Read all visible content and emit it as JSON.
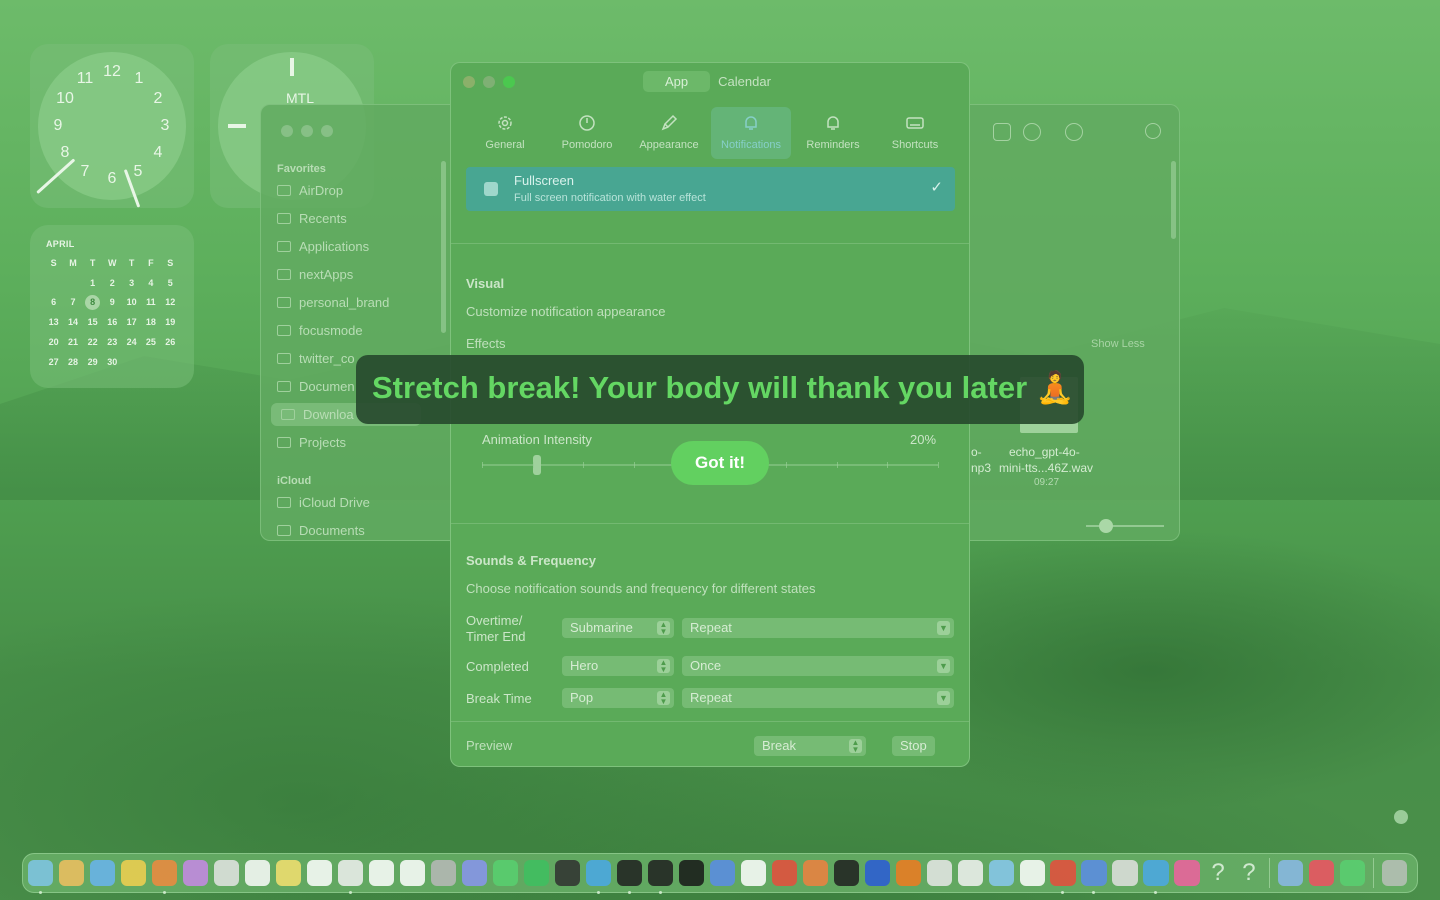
{
  "calendar": {
    "month": "APRIL",
    "weekdays": [
      "S",
      "M",
      "T",
      "W",
      "T",
      "F",
      "S"
    ],
    "weeks": [
      [
        "",
        "",
        "1",
        "2",
        "3",
        "4",
        "5"
      ],
      [
        "6",
        "7",
        "8",
        "9",
        "10",
        "11",
        "12"
      ],
      [
        "13",
        "14",
        "15",
        "16",
        "17",
        "18",
        "19"
      ],
      [
        "20",
        "21",
        "22",
        "23",
        "24",
        "25",
        "26"
      ],
      [
        "27",
        "28",
        "29",
        "30",
        "",
        "",
        ""
      ]
    ],
    "today": "8"
  },
  "clock": {
    "numbers": [
      "12",
      "1",
      "2",
      "3",
      "4",
      "5",
      "6",
      "7",
      "8",
      "9",
      "10",
      "11"
    ],
    "city_label": "MTL"
  },
  "finder": {
    "favorites_header": "Favorites",
    "favorites": [
      "AirDrop",
      "Recents",
      "Applications",
      "nextApps",
      "personal_brand",
      "focusmode",
      "twitter_co",
      "Documen",
      "Downloa",
      "Projects"
    ],
    "icloud_header": "iCloud",
    "icloud": [
      "iCloud Drive",
      "Documents"
    ],
    "show_less": "Show Less",
    "file_name_line1": "echo_gpt-4o-",
    "file_name_line2": "mini-tts...46Z.wav",
    "file_time": "09:27",
    "file_partial_1": "o-",
    "file_partial_2": "np3"
  },
  "window": {
    "segments": [
      "App",
      "Calendar"
    ],
    "active_segment": "App",
    "tabs": [
      {
        "label": "General",
        "icon": "gear-icon"
      },
      {
        "label": "Pomodoro",
        "icon": "timer-icon"
      },
      {
        "label": "Appearance",
        "icon": "paintbrush-icon"
      },
      {
        "label": "Notifications",
        "icon": "bell-icon"
      },
      {
        "label": "Reminders",
        "icon": "bell-badge-icon"
      },
      {
        "label": "Shortcuts",
        "icon": "keyboard-icon"
      }
    ],
    "active_tab": "Notifications",
    "fullscreen": {
      "title": "Fullscreen",
      "description": "Full screen notification with water effect"
    },
    "visual": {
      "header": "Visual",
      "subtitle": "Customize notification appearance",
      "effects_label": "Effects",
      "animation_label": "Animation Intensity",
      "animation_value": "20%",
      "animation_fraction": 0.12
    },
    "sounds": {
      "header": "Sounds & Frequency",
      "subtitle": "Choose notification sounds and frequency for different states",
      "rows": [
        {
          "label_line1": "Overtime/",
          "label_line2": "Timer End",
          "sound": "Submarine",
          "frequency": "Repeat"
        },
        {
          "label_line1": "Completed",
          "label_line2": "",
          "sound": "Hero",
          "frequency": "Once"
        },
        {
          "label_line1": "Break Time",
          "label_line2": "",
          "sound": "Pop",
          "frequency": "Repeat"
        }
      ]
    },
    "preview": {
      "label": "Preview",
      "selected": "Break",
      "stop_label": "Stop"
    }
  },
  "notification": {
    "message": "Stretch break! Your body will thank you later 🧘",
    "button_label": "Got it!"
  },
  "dock": {
    "icons": [
      "finder-icon",
      "launchpad-icon",
      "safari-icon",
      "chrome-icon",
      "brave-icon",
      "app-icon",
      "app-icon",
      "reminders-icon",
      "notes-icon",
      "notion-icon",
      "app-icon",
      "calendar-icon",
      "calendar-icon",
      "settings-icon",
      "discord-icon",
      "whatsapp-icon",
      "spotify-icon",
      "activity-monitor-icon",
      "docker-icon",
      "app-icon",
      "app-icon",
      "app-icon",
      "xcode-icon",
      "app-icon",
      "app-icon",
      "app-icon",
      "figma-icon",
      "bitwarden-icon",
      "vlc-icon",
      "app-icon",
      "app-icon",
      "app-icon",
      "chatgpt-icon",
      "app-icon",
      "app-icon",
      "app-icon",
      "app-icon",
      "app-icon",
      "help-icon",
      "help-icon",
      "preview-icon",
      "music-icon",
      "facetime-icon",
      "trash-icon"
    ]
  }
}
